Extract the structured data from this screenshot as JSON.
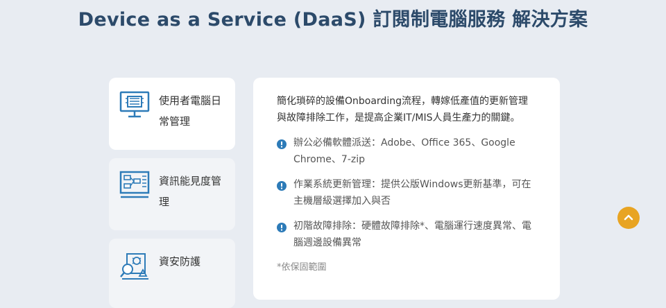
{
  "page": {
    "title": "Device as a Service (DaaS) 訂閱制電腦服務 解決方案"
  },
  "tabs": [
    {
      "label": "使用者電腦日常管理",
      "icon": "monitor-chip-icon",
      "active": true
    },
    {
      "label": "資訊能見度管理",
      "icon": "diagram-board-icon",
      "active": false
    },
    {
      "label": "資安防護",
      "icon": "security-scan-icon",
      "active": false
    }
  ],
  "content": {
    "intro": "簡化瑣碎的設備Onboarding流程，轉嫁低產值的更新管理與故障排除工作，是提高企業IT/MIS人員生產力的關鍵。",
    "items": [
      "辦公必備軟體派送：Adobe、Office 365、Google Chrome、7-zip",
      "作業系統更新管理：提供公版Windows更新基準，可在主機層級選擇加入與否",
      "初階故障排除：硬體故障排除*、電腦運行速度異常、電腦週邊設備異常"
    ],
    "note": "*依保固範圍"
  },
  "colors": {
    "title": "#2c4a6a",
    "icon": "#2d7bb8",
    "accent": "#e8a423",
    "background": "#e8ecf2"
  },
  "back_to_top": {
    "icon": "chevron-up-icon"
  }
}
